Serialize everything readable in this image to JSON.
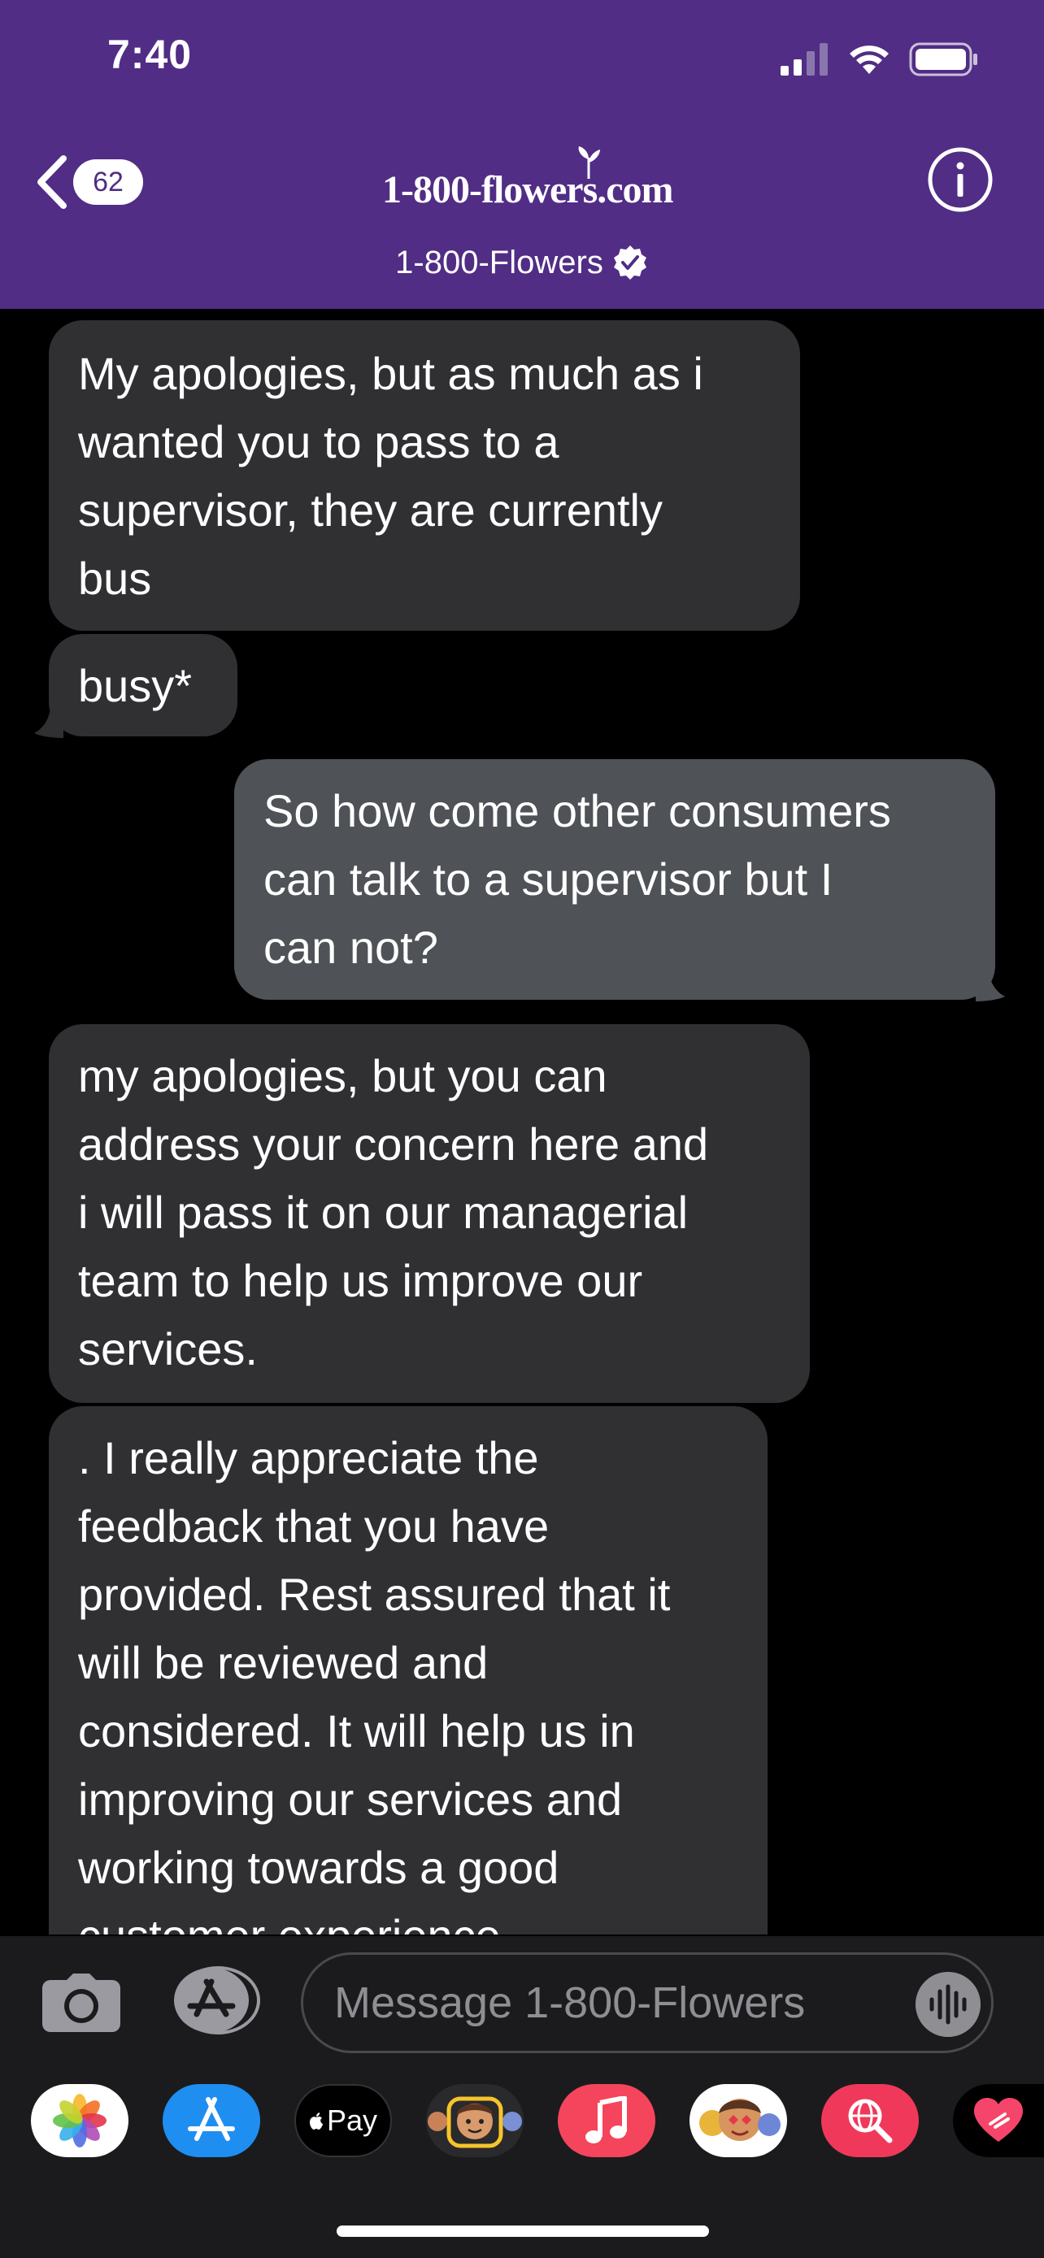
{
  "status_bar": {
    "time": "7:40"
  },
  "header": {
    "back_count": "62",
    "brand_logo_text": "1-800-flowers.com",
    "contact_name": "1-800-Flowers",
    "colors": {
      "background": "#512d85",
      "verified_badge": "#ffffff"
    }
  },
  "messages": [
    {
      "direction": "incoming",
      "text": "My apologies, but as much as i\nwanted you to pass to a\nsupervisor, they are currently\nbus"
    },
    {
      "direction": "incoming",
      "text": "busy*"
    },
    {
      "direction": "outgoing",
      "text": "So how come other consumers\ncan talk to a supervisor but I\ncan not?"
    },
    {
      "direction": "incoming",
      "text": "my apologies, but you can\naddress your concern here and\ni will pass it on our managerial\nteam to help us improve our\nservices."
    },
    {
      "direction": "incoming",
      "text": ". I really appreciate the\nfeedback that you have\nprovided. Rest assured that it\nwill be reviewed and\nconsidered. It will help us in\nimproving our services and\nworking towards a good\ncustomer experience."
    }
  ],
  "input_bar": {
    "placeholder": "Message 1-800-Flowers"
  },
  "app_drawer": {
    "apple_pay_label": "Pay",
    "apps": [
      "photos-icon",
      "app-store-icon",
      "apple-pay-icon",
      "memoji-icon",
      "music-icon",
      "memoji-stickers-icon",
      "image-search-icon",
      "digital-touch-icon"
    ]
  },
  "colors": {
    "incoming_bubble": "#303033",
    "outgoing_bubble": "#4f5256",
    "bar_background": "#1b1b1d"
  }
}
